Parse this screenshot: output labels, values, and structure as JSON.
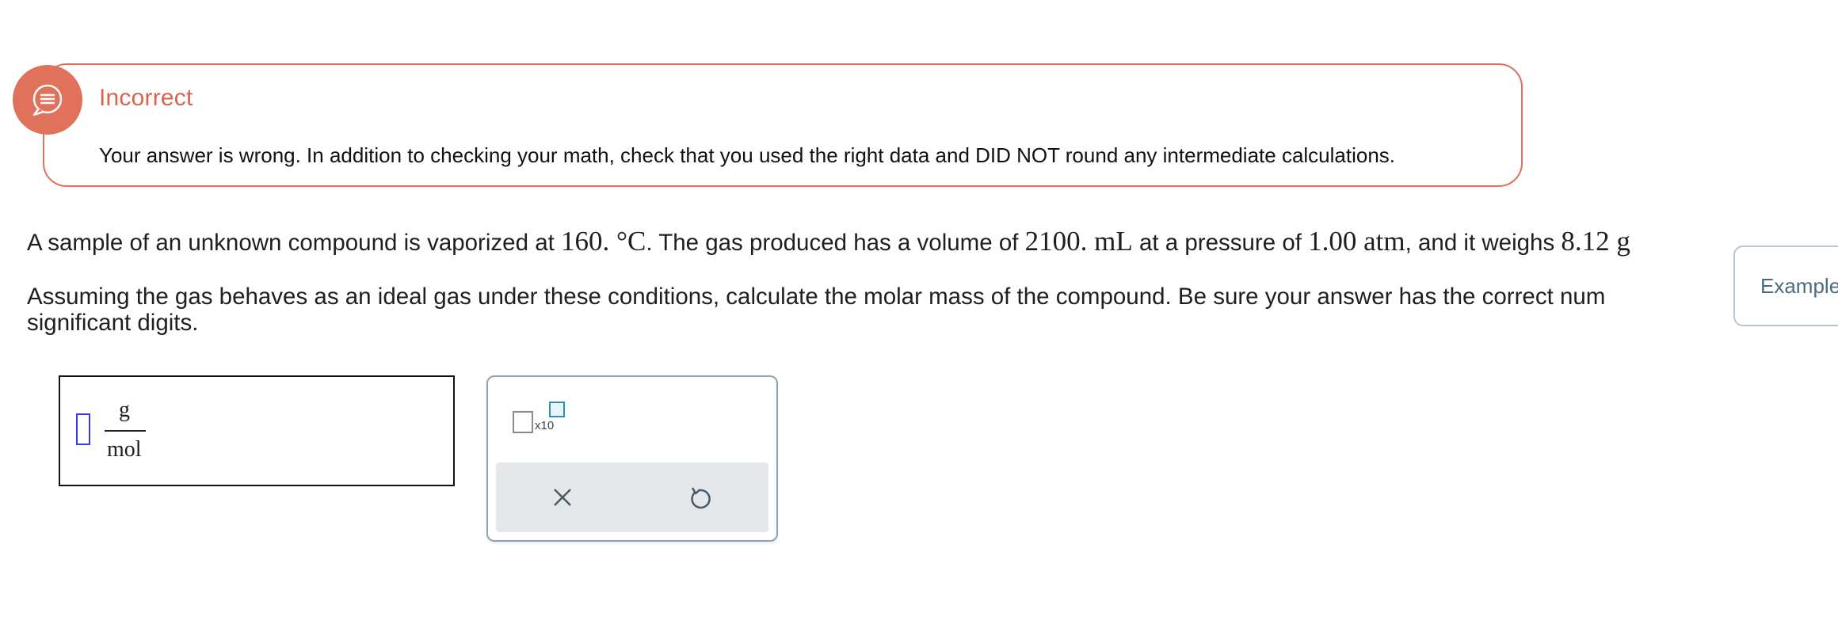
{
  "feedback": {
    "title": "Incorrect",
    "message": "Your answer is wrong. In addition to checking your math, check that you used the right data and DID NOT round any intermediate calculations."
  },
  "question": {
    "line1_a": "A sample of an unknown compound is vaporized at ",
    "temp": "160. °C",
    "line1_b": ". The gas produced has a volume of ",
    "volume": "2100. mL",
    "line1_c": " at a pressure of ",
    "pressure": "1.00 atm",
    "line1_d": ", and it weighs ",
    "mass": "8.12 g",
    "line2": "Assuming the gas behaves as an ideal gas under these conditions, calculate the molar mass of the compound. Be sure your answer has the correct num",
    "line3": "significant digits."
  },
  "answer": {
    "value": "",
    "unit_numerator": "g",
    "unit_denominator": "mol"
  },
  "tools": {
    "x10_label": "x10",
    "clear_icon": "close-icon",
    "undo_icon": "undo-icon"
  },
  "example_tab": {
    "label": "Example"
  },
  "colors": {
    "incorrect": "#e0715a",
    "cursor": "#3b3bdb",
    "example_text": "#4b6a83"
  }
}
